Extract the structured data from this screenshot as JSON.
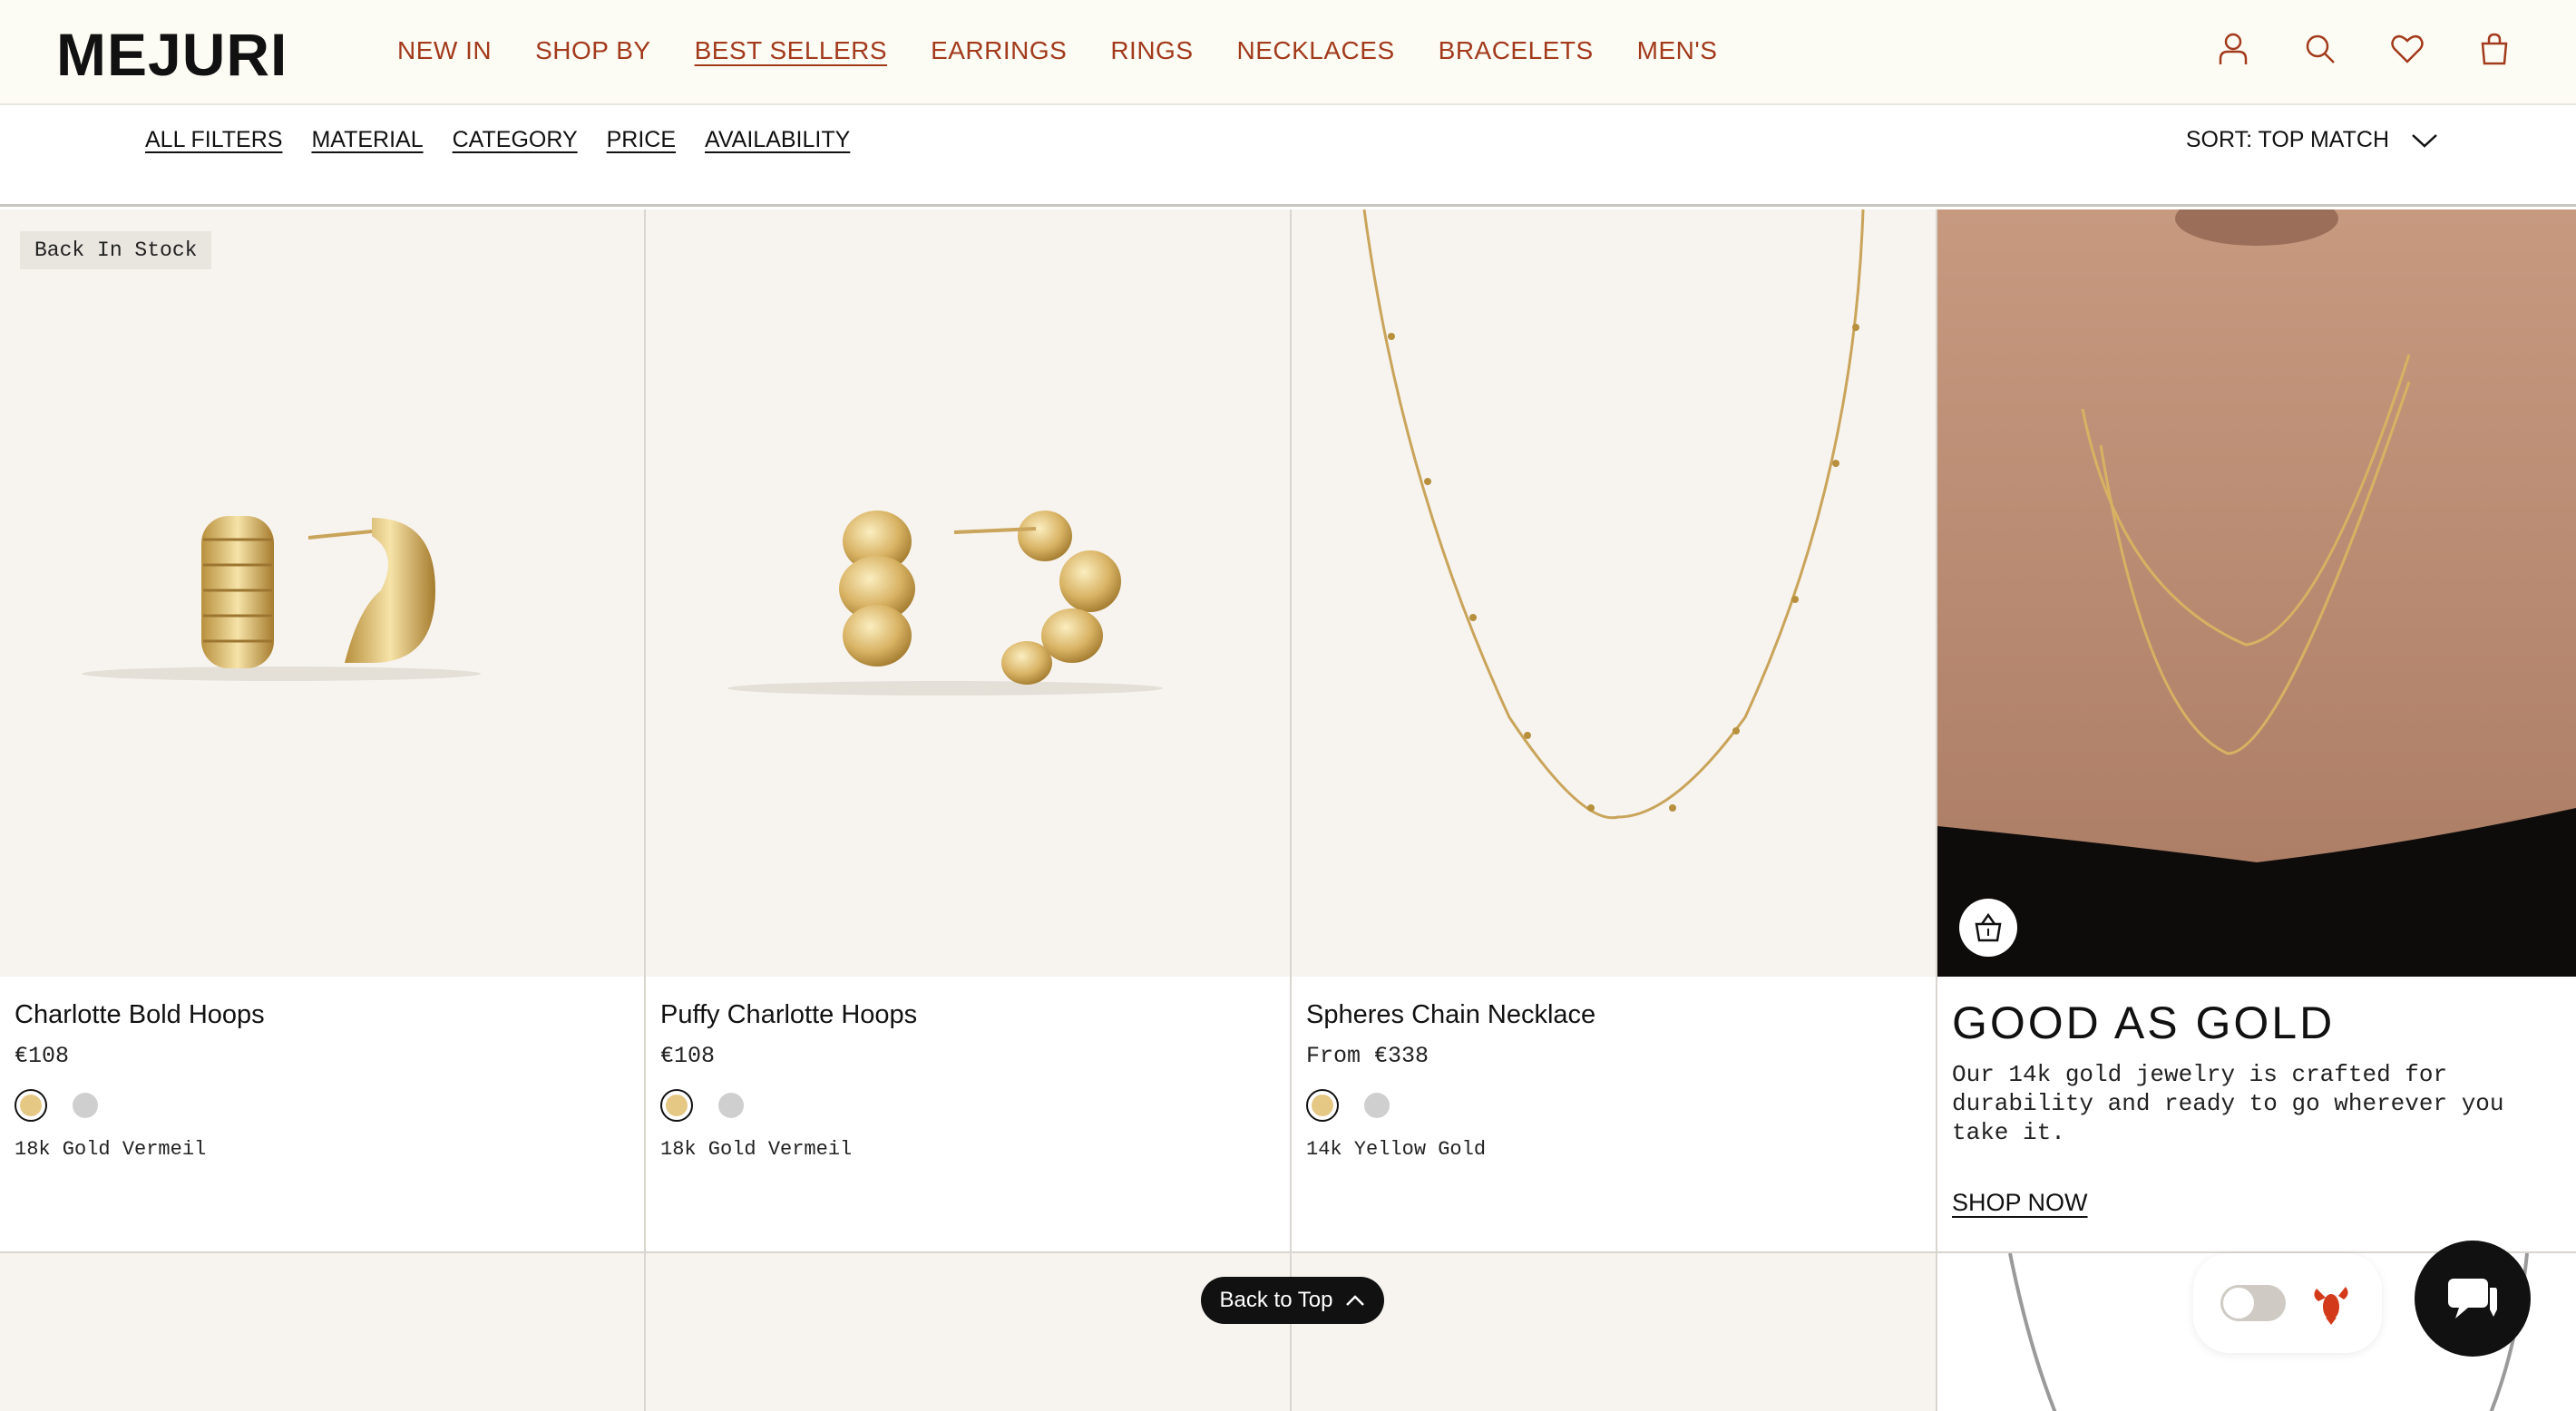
{
  "header": {
    "logo": "MEJURI",
    "nav": [
      "NEW IN",
      "SHOP BY",
      "BEST SELLERS",
      "EARRINGS",
      "RINGS",
      "NECKLACES",
      "BRACELETS",
      "MEN'S"
    ],
    "active_nav": "BEST SELLERS",
    "icons": [
      "user-icon",
      "search-icon",
      "heart-icon",
      "bag-icon"
    ]
  },
  "filters": {
    "items": [
      "ALL FILTERS",
      "MATERIAL",
      "CATEGORY",
      "PRICE",
      "AVAILABILITY"
    ],
    "sort_label": "SORT: TOP MATCH"
  },
  "products": [
    {
      "badge": "Back In Stock",
      "name": "Charlotte Bold Hoops",
      "price": "€108",
      "material": "18k Gold Vermeil"
    },
    {
      "badge": "",
      "name": "Puffy Charlotte Hoops",
      "price": "€108",
      "material": "18k Gold Vermeil"
    },
    {
      "badge": "",
      "name": "Spheres Chain Necklace",
      "price": "From €338",
      "material": "14k Yellow Gold"
    }
  ],
  "promo": {
    "title": "GOOD AS GOLD",
    "text": "Our 14k gold jewelry is crafted for durability and ready to go wherever you take it.",
    "link": "SHOP NOW"
  },
  "back_to_top": "Back to Top",
  "colors": {
    "nav_text": "#a23a1c",
    "header_bg": "#fdfcf4",
    "gold_swatch": "#e6c885",
    "silver_swatch": "#cfcfcf"
  }
}
